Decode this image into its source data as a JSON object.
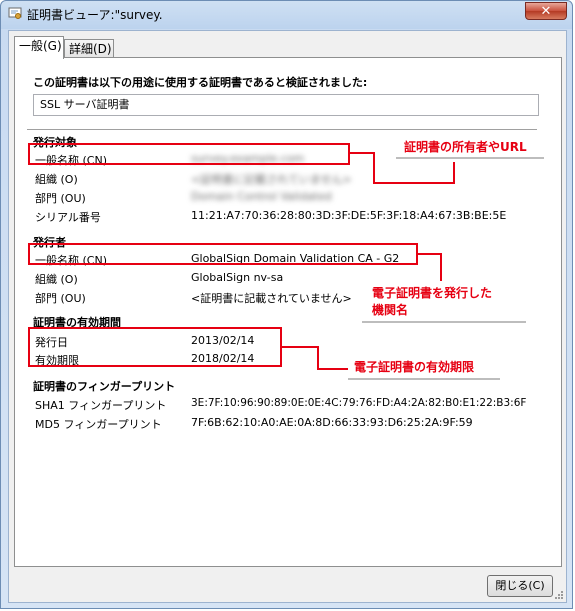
{
  "window": {
    "title": "証明書ビューア:\"survey.",
    "close_glyph": "✕"
  },
  "tabs": [
    {
      "label": "一般(G)"
    },
    {
      "label": "詳細(D)"
    }
  ],
  "purpose": {
    "heading": "この証明書は以下の用途に使用する証明書であると検証されました:",
    "value": "SSL サーバ証明書"
  },
  "issued_to": {
    "heading": "発行対象",
    "cn_label": "一般名称 (CN)",
    "cn_value": "survey.example.com",
    "o_label": "組織 (O)",
    "o_value": "<証明書に記載されていません>",
    "ou_label": "部門 (OU)",
    "ou_value": "Domain Control Validated",
    "serial_label": "シリアル番号",
    "serial_value": "11:21:A7:70:36:28:80:3D:3F:DE:5F:3F:18:A4:67:3B:BE:5E"
  },
  "issued_by": {
    "heading": "発行者",
    "cn_label": "一般名称 (CN)",
    "cn_value": "GlobalSign Domain Validation CA - G2",
    "o_label": "組織 (O)",
    "o_value": "GlobalSign nv-sa",
    "ou_label": "部門 (OU)",
    "ou_value": "<証明書に記載されていません>"
  },
  "validity": {
    "heading": "証明書の有効期間",
    "issued_label": "発行日",
    "issued_value": "2013/02/14",
    "expires_label": "有効期限",
    "expires_value": "2018/02/14"
  },
  "fingerprints": {
    "heading": "証明書のフィンガープリント",
    "sha1_label": "SHA1 フィンガープリント",
    "sha1_value": "3E:7F:10:96:90:89:0E:0E:4C:79:76:FD:A4:2A:82:B0:E1:22:B3:6F",
    "md5_label": "MD5 フィンガープリント",
    "md5_value": "7F:6B:62:10:A0:AE:0A:8D:66:33:93:D6:25:2A:9F:59"
  },
  "annotations": {
    "owner": "証明書の所有者やURL",
    "issuer_line1": "電子証明書を発行した",
    "issuer_line2": "機関名",
    "validity": "電子証明書の有効期限"
  },
  "buttons": {
    "close": "閉じる(C)"
  },
  "colors": {
    "annotation_red": "#e60012",
    "title_bar": "#bcd3ee",
    "close_button": "#c9503c"
  }
}
